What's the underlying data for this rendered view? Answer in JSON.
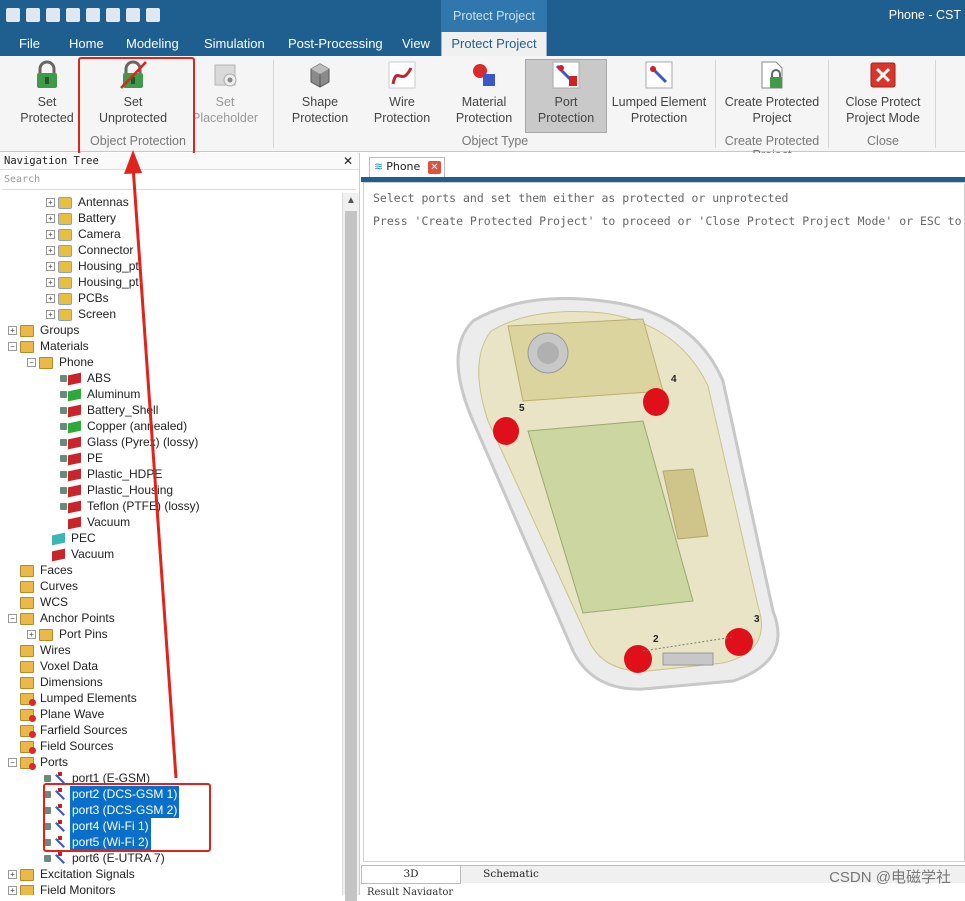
{
  "titlebar": {
    "context_tab_title": "Protect Project",
    "window_title": "Phone - CST"
  },
  "menu_tabs": [
    {
      "label": "File"
    },
    {
      "label": "Home"
    },
    {
      "label": "Modeling"
    },
    {
      "label": "Simulation"
    },
    {
      "label": "Post-Processing"
    },
    {
      "label": "View"
    },
    {
      "label": "Protect Project"
    }
  ],
  "ribbon": {
    "buttons": [
      {
        "line1": "Set",
        "line2": "Protected"
      },
      {
        "line1": "Set",
        "line2": "Unprotected"
      },
      {
        "line1": "Set",
        "line2": "Placeholder"
      },
      {
        "line1": "Shape",
        "line2": "Protection"
      },
      {
        "line1": "Wire",
        "line2": "Protection"
      },
      {
        "line1": "Material",
        "line2": "Protection"
      },
      {
        "line1": "Port",
        "line2": "Protection"
      },
      {
        "line1": "Lumped Element",
        "line2": "Protection"
      },
      {
        "line1": "Create Protected",
        "line2": "Project"
      },
      {
        "line1": "Close Protect",
        "line2": "Project Mode"
      }
    ],
    "groups": {
      "object_protection": "Object Protection",
      "object_type": "Object Type",
      "create_protected_project": "Create Protected Project",
      "close": "Close"
    }
  },
  "nav": {
    "title": "Navigation Tree",
    "close_glyph": "✕",
    "search_placeholder": "Search",
    "items": [
      {
        "label": "Antennas"
      },
      {
        "label": "Battery"
      },
      {
        "label": "Camera"
      },
      {
        "label": "Connector"
      },
      {
        "label": "Housing_pt"
      },
      {
        "label": "Housing_pt"
      },
      {
        "label": "PCBs"
      },
      {
        "label": "Screen"
      },
      {
        "label": "Groups"
      },
      {
        "label": "Materials"
      },
      {
        "label": "Phone"
      },
      {
        "label": "ABS"
      },
      {
        "label": "Aluminum"
      },
      {
        "label": "Battery_Shell"
      },
      {
        "label": "Copper (annealed)"
      },
      {
        "label": "Glass (Pyrex) (lossy)"
      },
      {
        "label": "PE"
      },
      {
        "label": "Plastic_HDPE"
      },
      {
        "label": "Plastic_Housing"
      },
      {
        "label": "Teflon (PTFE) (lossy)"
      },
      {
        "label": "Vacuum"
      },
      {
        "label": "PEC"
      },
      {
        "label": "Vacuum"
      },
      {
        "label": "Faces"
      },
      {
        "label": "Curves"
      },
      {
        "label": "WCS"
      },
      {
        "label": "Anchor Points"
      },
      {
        "label": "Port Pins"
      },
      {
        "label": "Wires"
      },
      {
        "label": "Voxel Data"
      },
      {
        "label": "Dimensions"
      },
      {
        "label": "Lumped Elements"
      },
      {
        "label": "Plane Wave"
      },
      {
        "label": "Farfield Sources"
      },
      {
        "label": "Field Sources"
      },
      {
        "label": "Ports"
      },
      {
        "label": "port1 (E-GSM)"
      },
      {
        "label": "port2 (DCS-GSM 1)"
      },
      {
        "label": "port3 (DCS-GSM 2)"
      },
      {
        "label": "port4 (Wi-Fi 1)"
      },
      {
        "label": "port5 (Wi-Fi 2)"
      },
      {
        "label": "port6 (E-UTRA 7)"
      },
      {
        "label": "Excitation Signals"
      },
      {
        "label": "Field Monitors"
      }
    ]
  },
  "document": {
    "tab_label": "Phone",
    "message_line1": "Select ports and set them either as protected or unprotected",
    "message_line2": "Press 'Create Protected Project' to proceed or 'Close Protect Project Mode' or ESC to cancel",
    "port_labels": [
      "4",
      "5",
      "2",
      "3"
    ],
    "bottom_tabs": [
      "3D",
      "Schematic"
    ],
    "result_navigator": "Result Navigator"
  },
  "watermark": "CSDN @电磁学社",
  "colors": {
    "titlebar": "#1e5f8f",
    "selection": "#0a6fc9",
    "annotation_red": "#e2231a",
    "port_marker": "#e0101a"
  }
}
